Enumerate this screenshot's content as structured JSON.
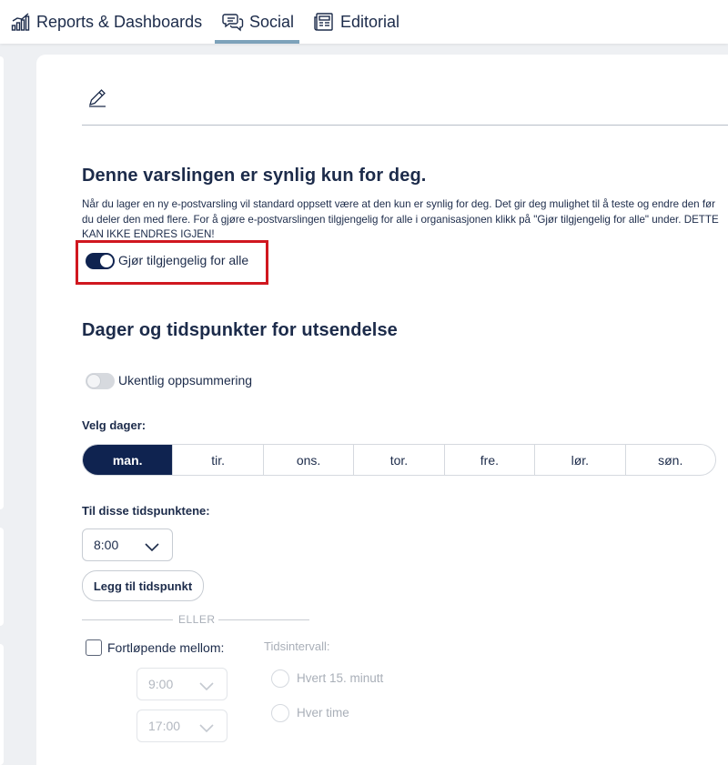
{
  "nav": {
    "tabs": [
      {
        "label": "Reports & Dashboards",
        "icon": "bar-chart-icon"
      },
      {
        "label": "Social",
        "icon": "chat-bubbles-icon",
        "active": true
      },
      {
        "label": "Editorial",
        "icon": "newspaper-icon"
      }
    ]
  },
  "visibility": {
    "heading": "Denne varslingen er synlig kun for deg.",
    "description": "Når du lager en ny e-postvarsling vil standard oppsett være at den kun er synlig for deg. Det gir deg mulighet til å teste og endre den før du deler den med flere. For å gjøre e-postvarslingen tilgjengelig for alle i organisasjonen klikk på \"Gjør tilgjengelig for alle\" under. DETTE KAN IKKE ENDRES IGJEN!",
    "toggle_label": "Gjør tilgjengelig for alle",
    "toggle_on": true
  },
  "schedule": {
    "heading": "Dager og tidspunkter for utsendelse",
    "weekly_label": "Ukentlig oppsummering",
    "weekly_on": false,
    "days_label": "Velg dager:",
    "days": [
      "man.",
      "tir.",
      "ons.",
      "tor.",
      "fre.",
      "lør.",
      "søn."
    ],
    "selected_day": "man.",
    "times_label": "Til disse tidspunktene:",
    "time_value": "8:00",
    "add_time_button": "Legg til tidspunkt",
    "or_text": "ELLER",
    "continuous_label": "Fortløpende mellom:",
    "continuous_checked": false,
    "from_time": "9:00",
    "to_time": "17:00",
    "interval_label": "Tidsintervall:",
    "interval_options": [
      "Hvert 15. minutt",
      "Hver time"
    ]
  },
  "colors": {
    "primary": "#0f2350",
    "highlight_border": "#d0171f",
    "tab_underline": "#7da2ba"
  }
}
